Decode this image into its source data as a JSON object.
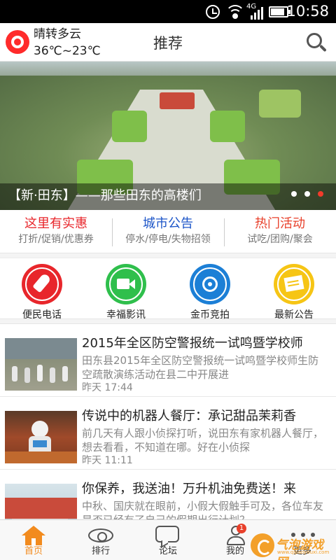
{
  "status_bar": {
    "network": "4G",
    "time": "10:58"
  },
  "header": {
    "weather": "晴转多云",
    "temperature": "36℃~23℃",
    "title": "推荐"
  },
  "banner": {
    "caption": "【新·田东】——那些田东的高楼们",
    "slide_count": 3,
    "active_slide": 3
  },
  "promos": [
    {
      "title": "这里有实惠",
      "subtitle": "打折/促销/优惠券",
      "color": "#e8262b"
    },
    {
      "title": "城市公告",
      "subtitle": "停水/停电/失物招领",
      "color": "#1c55c8"
    },
    {
      "title": "热门活动",
      "subtitle": "试吃/团购/聚会",
      "color": "#e8402b"
    }
  ],
  "quick_links": [
    {
      "label": "便民电话",
      "icon": "rocket-icon"
    },
    {
      "label": "幸福影讯",
      "icon": "video-camera-icon"
    },
    {
      "label": "金币竞拍",
      "icon": "coin-icon"
    },
    {
      "label": "最新公告",
      "icon": "notice-icon"
    }
  ],
  "news": [
    {
      "title": "2015年全区防空警报统一试鸣暨学校师",
      "summary": "田东县2015年全区防空警报统一试鸣暨学校师生防空疏散演练活动在县二中开展进",
      "time": "昨天 17:44"
    },
    {
      "title": "传说中的机器人餐厅：承记甜品茉莉香",
      "summary": "前几天有人跟小侦探打听，说田东有家机器人餐厅，想去看看，不知道在哪。好在小侦探",
      "time": "昨天 11:11"
    },
    {
      "title": "你保养，我送油！万升机油免费送！来",
      "summary": "中秋、国庆就在眼前，小假大假触手可及，各位车友是否已经有了自己的假期出行计划？",
      "time": ""
    }
  ],
  "tabbar": {
    "items": [
      {
        "label": "首页",
        "icon": "home-icon"
      },
      {
        "label": "排行",
        "icon": "eye-icon"
      },
      {
        "label": "论坛",
        "icon": "chat-icon"
      },
      {
        "label": "我的",
        "icon": "user-icon"
      },
      {
        "label": "更多",
        "icon": "more-icon"
      }
    ],
    "active": "首页",
    "my_badge": "1",
    "accent": "#f28b1e"
  },
  "watermark": {
    "text": "气泡游戏网",
    "url": "www.qipaoyouxi.com"
  }
}
